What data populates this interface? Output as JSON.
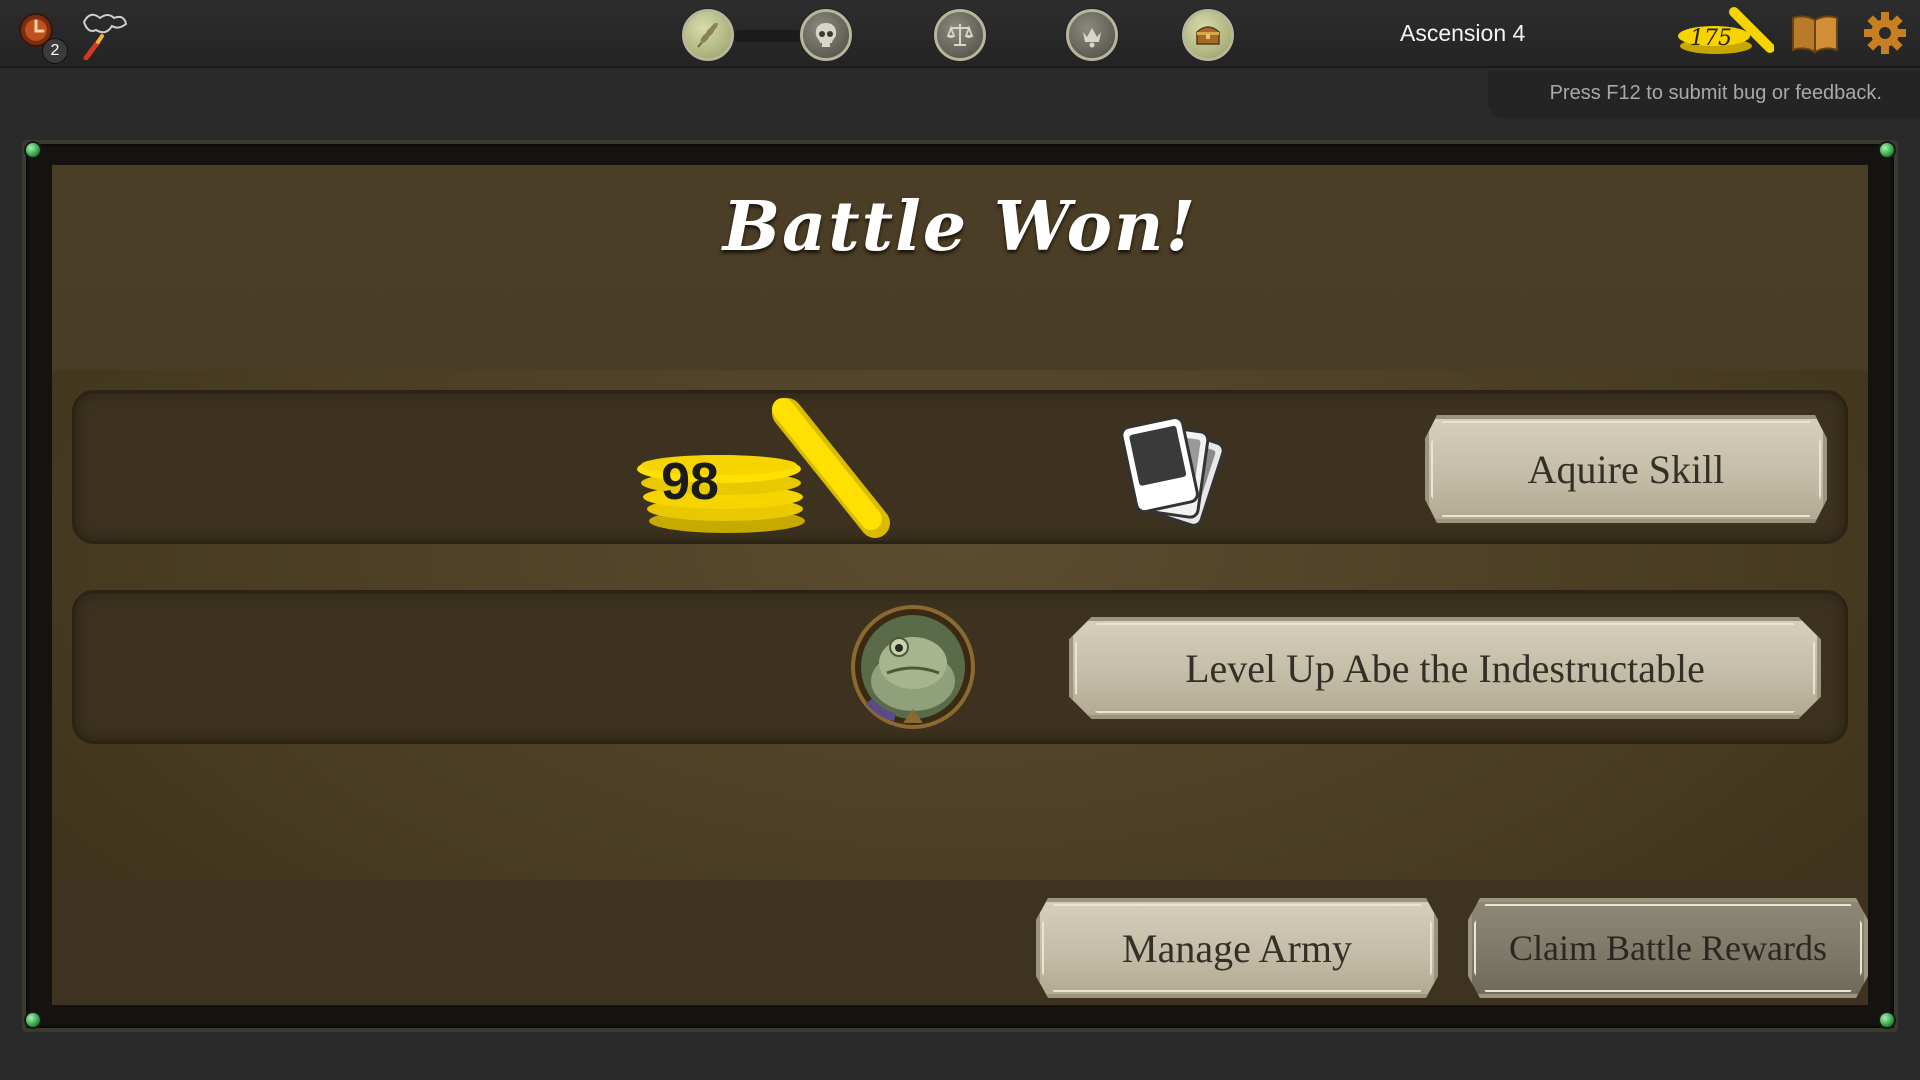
{
  "hud": {
    "left": {
      "clock_badge_count": "2",
      "clock_icon": "hourglass-clock-icon",
      "map_icon": "treasure-map-icon"
    },
    "map_nodes": [
      {
        "icon": "wheat-icon",
        "state": "visited"
      },
      {
        "icon": "skull-icon",
        "state": "current"
      },
      {
        "icon": "scales-icon",
        "state": "upcoming"
      },
      {
        "icon": "crown-icon",
        "state": "upcoming"
      },
      {
        "icon": "treasure-chest-icon",
        "state": "visited"
      }
    ],
    "ascension_label": "Ascension 4",
    "gold_total": "175",
    "book_icon": "codex-book-icon",
    "settings_icon": "gear-icon"
  },
  "feedback": {
    "text": "Press F12 to submit bug or feedback."
  },
  "panel": {
    "title": "Battle Won!",
    "rewards": {
      "gold_amount": "98",
      "gold_icon": "gold-coins-icon",
      "cards_icon": "skill-cards-icon",
      "acquire_skill_label": "Aquire Skill",
      "hero_portrait_icon": "toad-hero-portrait",
      "level_up_label": "Level Up Abe the Indestructable"
    },
    "footer": {
      "manage_army_label": "Manage Army",
      "claim_rewards_label": "Claim Battle Rewards"
    }
  },
  "colors": {
    "gold": "#f5d400",
    "panel_brown": "#4b3e26",
    "stone_button": "#c8c1ab",
    "corner_gem": "#2f9d46"
  }
}
